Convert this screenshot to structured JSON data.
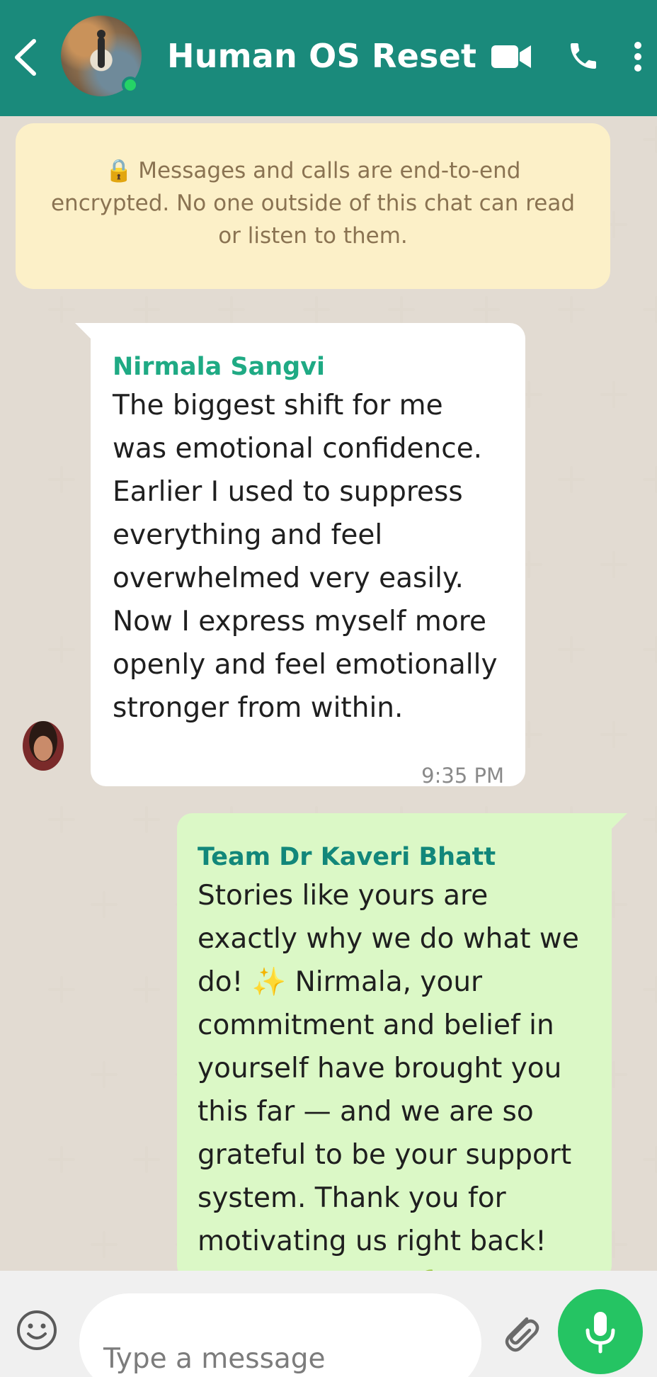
{
  "header": {
    "title": "Human OS Reset",
    "icons": [
      "back-arrow-icon",
      "video-call-icon",
      "phone-icon",
      "more-vert-icon"
    ]
  },
  "notice": {
    "lock_emoji": "🔒",
    "text": "Messages and calls are end-to-end encrypted. No one outside of this chat can read or listen to them."
  },
  "messages": [
    {
      "direction": "incoming",
      "sender": "Nirmala Sangvi",
      "text": "The biggest shift for me was emotional confidence. Earlier I used to suppress everything and feel overwhelmed very easily. Now I express myself more openly and feel emotionally stronger from within.",
      "time": "9:35 PM"
    },
    {
      "direction": "outgoing",
      "sender": "Team Dr Kaveri Bhatt",
      "text": "Stories like yours are exactly why we do what we do! ✨ Nirmala, your commitment and belief in yourself have brought you this far — and we are so grateful to be your support system. Thank you for motivating us right back! Keep thriving! 🌱"
    }
  ],
  "composer": {
    "placeholder": "Type a message"
  },
  "colors": {
    "header": "#1a8a7b",
    "incoming_sender": "#1faa84",
    "outgoing_sender": "#12877a",
    "outgoing_bubble": "#dbf8c6",
    "mic_button": "#25c463"
  }
}
